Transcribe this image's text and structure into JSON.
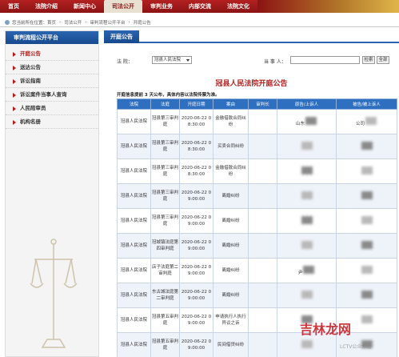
{
  "topnav": {
    "items": [
      "首页",
      "法院介绍",
      "新闻中心",
      "司法公开",
      "审判业务",
      "内部交流",
      "法院文化"
    ],
    "active_index": 3,
    "accent": "#8c1313"
  },
  "breadcrumb": [
    "您当前所在位置：首页",
    "司法公开",
    "审判流程公开平台",
    "开庭公告"
  ],
  "sidebar": {
    "title": "审判流程公开平台",
    "items": [
      "开庭公告",
      "送达公告",
      "诉讼指南",
      "诉讼案件当事人查询",
      "人民陪审员",
      "机构名册"
    ],
    "active_index": 0
  },
  "main": {
    "tab": "开庭公告",
    "filter": {
      "court_label": "法 院：",
      "court_value": "冠县人民法院",
      "party_label": "当 事 人：",
      "party_placeholder": "",
      "search_button": "检索",
      "all_button": "全部"
    },
    "notice_title": "冠县人民法院开庭公告",
    "notice_desc": "开庭信息提前 3 天公布，具体内容以法院传票为准。",
    "table": {
      "headers": [
        "法院",
        "法庭",
        "开庭日期",
        "案由",
        "审判长",
        "原告/上诉人",
        "被告/被上诉人"
      ],
      "rows": [
        [
          "冠县人民法院",
          "冠县第三审判庭",
          "2020-06-22 08:30:00",
          "金融借款合同纠纷",
          "",
          "山东",
          "公司"
        ],
        [
          "冠县人民法院",
          "冠县第三审判庭",
          "2020-06-22 08:30:00",
          "买卖合同纠纷",
          "",
          "",
          ""
        ],
        [
          "冠县人民法院",
          "冠县第三审判庭",
          "2020-06-22 08:30:00",
          "金融借款合同纠纷",
          "",
          "",
          ""
        ],
        [
          "冠县人民法院",
          "冠县第三审判庭",
          "2020-06-22 09:00:00",
          "离婚纠纷",
          "",
          "",
          ""
        ],
        [
          "冠县人民法院",
          "冠县第三审判庭",
          "2020-06-22 09:00:00",
          "离婚纠纷",
          "",
          "",
          ""
        ],
        [
          "冠县人民法院",
          "冠城镇法庭第四审判庭",
          "2020-06-22 09:00:00",
          "离婚纠纷",
          "",
          "",
          ""
        ],
        [
          "冠县人民法院",
          "店子法庭第二审判庭",
          "2020-06-22 09:00:00",
          "离婚纠纷",
          "",
          "尹",
          ""
        ],
        [
          "冠县人民法院",
          "东古城法庭第二审判庭",
          "2020-06-22 09:00:00",
          "离婚纠纷",
          "",
          "",
          ""
        ],
        [
          "冠县人民法院",
          "冠县第五审判庭",
          "2020-06-22 09:00:00",
          "申请执行人执行异议之诉",
          "",
          "",
          ""
        ],
        [
          "冠县人民法院",
          "冠县第五审判庭",
          "2020-06-22 09:00:00",
          "民间借贷纠纷",
          "",
          "",
          ""
        ]
      ]
    }
  },
  "watermark": {
    "text": "吉林龙网",
    "sub": "LCTV公众频道"
  }
}
